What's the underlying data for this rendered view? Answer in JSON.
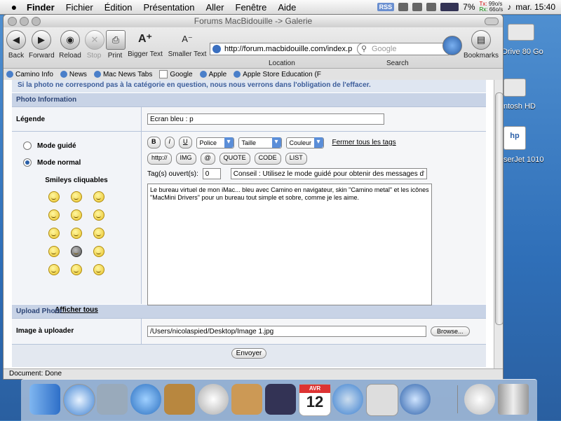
{
  "menubar": {
    "apple": "",
    "items": [
      "Finder",
      "Fichier",
      "Édition",
      "Présentation",
      "Aller",
      "Fenêtre",
      "Aide"
    ],
    "rss": "RSS",
    "battery": "7%",
    "tx_label": "Tx:",
    "rx_label": "Rx:",
    "tx_rate": "99o/s",
    "rx_rate": "66o/s",
    "clock": "mar. 15:40"
  },
  "desktop": {
    "drive": "Drive 80 Go",
    "hd": "ntosh HD",
    "printer": "serJet 1010",
    "hp_logo": "hp"
  },
  "window": {
    "title": "Forums MacBidouille -> Galerie",
    "toolbar": {
      "back": "Back",
      "forward": "Forward",
      "reload": "Reload",
      "stop": "Stop",
      "print": "Print",
      "bigger": "Bigger Text",
      "smaller": "Smaller Text",
      "url": "http://forum.macbidouille.com/index.p",
      "location_label": "Location",
      "search_placeholder": "Google",
      "search_label": "Search",
      "bookmarks": "Bookmarks"
    },
    "bookmark_bar": [
      "Camino Info",
      "News",
      "Mac News Tabs",
      "Google",
      "Apple",
      "Apple Store Education (F"
    ],
    "status": "Document: Done"
  },
  "form": {
    "notice": "Si la photo ne correspond pas à la catégorie en question, nous nous verrons dans l'obligation de l'effacer.",
    "photo_info_header": "Photo Information",
    "legende_label": "Légende",
    "legende_value": "Ecran bleu : p",
    "mode_guide": "Mode guidé",
    "mode_normal": "Mode normal",
    "smileys_title": "Smileys cliquables",
    "afficher_tous": "Afficher tous",
    "btn_b": "B",
    "btn_i": "I",
    "btn_u": "U",
    "police": "Police",
    "taille": "Taille",
    "couleur": "Couleur",
    "fermer_tags": "Fermer tous les tags",
    "btn_http": "http://",
    "btn_img": "IMG",
    "btn_at": "@",
    "btn_quote": "QUOTE",
    "btn_code": "CODE",
    "btn_list": "LIST",
    "tags_open_label": "Tag(s) ouvert(s):",
    "tags_open_value": "0",
    "conseil": "Conseil : Utilisez le mode guidé pour obtenir des messages d'a",
    "message": "Le bureau virtuel de mon iMac... bleu avec Camino en navigateur, skin \"Camino metal\" et les icônes \"MacMini Drivers\" pour un bureau tout simple et sobre, comme je les aime.",
    "upload_header": "Upload Photo",
    "image_label": "Image à uploader",
    "image_path": "/Users/nicolaspied/Desktop/Image 1.jpg",
    "browse": "Browse...",
    "submit": "Envoyer"
  },
  "dock": {
    "calendar_month": "AVR",
    "calendar_day": "12"
  }
}
